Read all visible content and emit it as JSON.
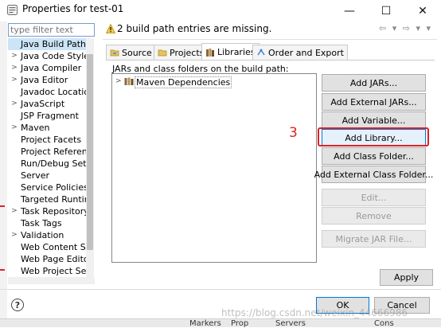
{
  "window": {
    "title": "Properties for test-01",
    "minimize": "—",
    "maximize": "☐",
    "close": "✕"
  },
  "filter": {
    "placeholder": "type filter text"
  },
  "tree": {
    "items": [
      {
        "label": "Java Build Path",
        "selected": true,
        "expandable": false
      },
      {
        "label": "Java Code Style",
        "expandable": true
      },
      {
        "label": "Java Compiler",
        "expandable": true
      },
      {
        "label": "Java Editor",
        "expandable": true
      },
      {
        "label": "Javadoc Location",
        "expandable": false
      },
      {
        "label": "JavaScript",
        "expandable": true
      },
      {
        "label": "JSP Fragment",
        "expandable": false
      },
      {
        "label": "Maven",
        "expandable": true
      },
      {
        "label": "Project Facets",
        "expandable": false
      },
      {
        "label": "Project References",
        "expandable": false
      },
      {
        "label": "Run/Debug Settings",
        "expandable": false
      },
      {
        "label": "Server",
        "expandable": false
      },
      {
        "label": "Service Policies",
        "expandable": false
      },
      {
        "label": "Targeted Runtimes",
        "expandable": false
      },
      {
        "label": "Task Repository",
        "expandable": true
      },
      {
        "label": "Task Tags",
        "expandable": false
      },
      {
        "label": "Validation",
        "expandable": true
      },
      {
        "label": "Web Content Settings",
        "expandable": false
      },
      {
        "label": "Web Page Editor",
        "expandable": false
      },
      {
        "label": "Web Project Settings",
        "expandable": false
      }
    ]
  },
  "header": {
    "message": "2 build path entries are missing.",
    "nav": "⇦ ▾ ⇨ ▾ ▾"
  },
  "tabs": [
    {
      "label": "Source",
      "active": false
    },
    {
      "label": "Projects",
      "active": false
    },
    {
      "label": "Libraries",
      "active": true
    },
    {
      "label": "Order and Export",
      "active": false
    }
  ],
  "libraries": {
    "list_label": "JARs and class folders on the build path:",
    "entries": [
      {
        "label": "Maven Dependencies"
      }
    ]
  },
  "buttons": {
    "add_jars": "Add JARs...",
    "add_external_jars": "Add External JARs...",
    "add_variable": "Add Variable...",
    "add_library": "Add Library...",
    "add_class_folder": "Add Class Folder...",
    "add_external_class_folder": "Add External Class Folder...",
    "edit": "Edit...",
    "remove": "Remove",
    "migrate_jar": "Migrate JAR File...",
    "apply": "Apply",
    "ok": "OK",
    "cancel": "Cancel",
    "help": "?"
  },
  "annotation": {
    "number": "3"
  },
  "watermark": "https://blog.csdn.net/weixin_44666986",
  "background_tabs": [
    "Markers",
    "Prop",
    "Servers",
    "Cons"
  ],
  "colors": {
    "selection": "#cce4f7",
    "highlight_box": "#e02020",
    "focus_blue": "#0078d7"
  }
}
